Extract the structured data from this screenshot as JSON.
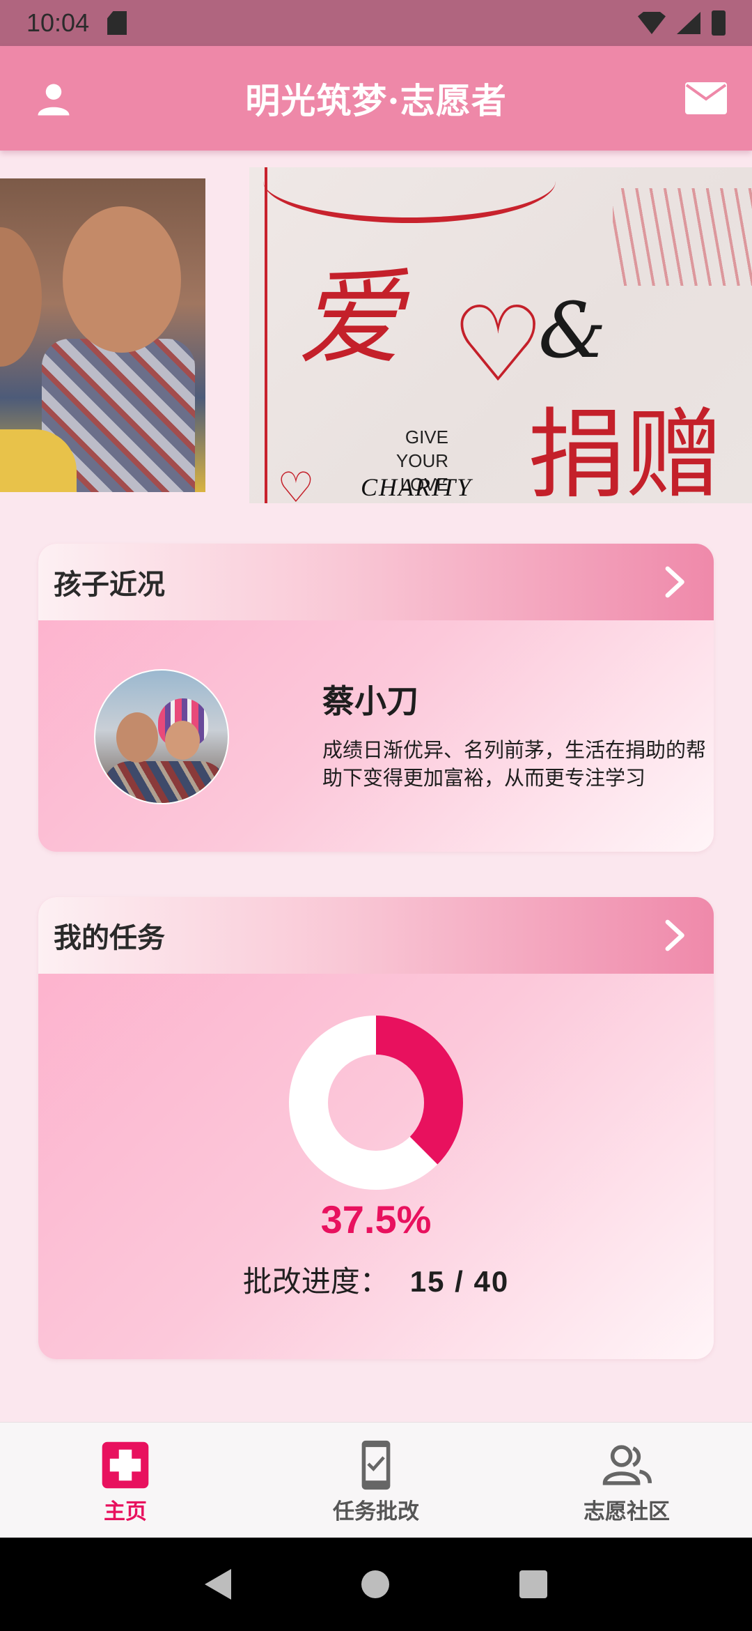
{
  "status_bar": {
    "time": "10:04"
  },
  "app_bar": {
    "title": "明光筑梦·志愿者"
  },
  "banner": {
    "charity_card": {
      "chars_love": "爱",
      "heart_glyph": "♡",
      "amp": "&",
      "chars_donate": "捐赠",
      "give_line1": "GIVE",
      "give_line2": "YOUR LOVE",
      "charity": "CHARITY"
    }
  },
  "kids_section": {
    "title": "孩子近况",
    "name": "蔡小刀",
    "description": "成绩日渐优异、名列前茅，生活在捐助的帮助下变得更加富裕，从而更专注学习"
  },
  "tasks_section": {
    "title": "我的任务",
    "percent_label": "37.5%",
    "progress_label": "批改进度：",
    "progress_numbers": "15 / 40",
    "progress_fraction": 0.375,
    "done": 15,
    "total": 40
  },
  "colors": {
    "accent": "#e8115e",
    "appbar": "#ee88a8",
    "donut_track": "#ffffff"
  },
  "bottom_nav": {
    "items": [
      {
        "label": "主页",
        "icon": "medical-cross-icon",
        "active": true
      },
      {
        "label": "任务批改",
        "icon": "phone-check-icon",
        "active": false
      },
      {
        "label": "志愿社区",
        "icon": "people-icon",
        "active": false
      }
    ]
  }
}
